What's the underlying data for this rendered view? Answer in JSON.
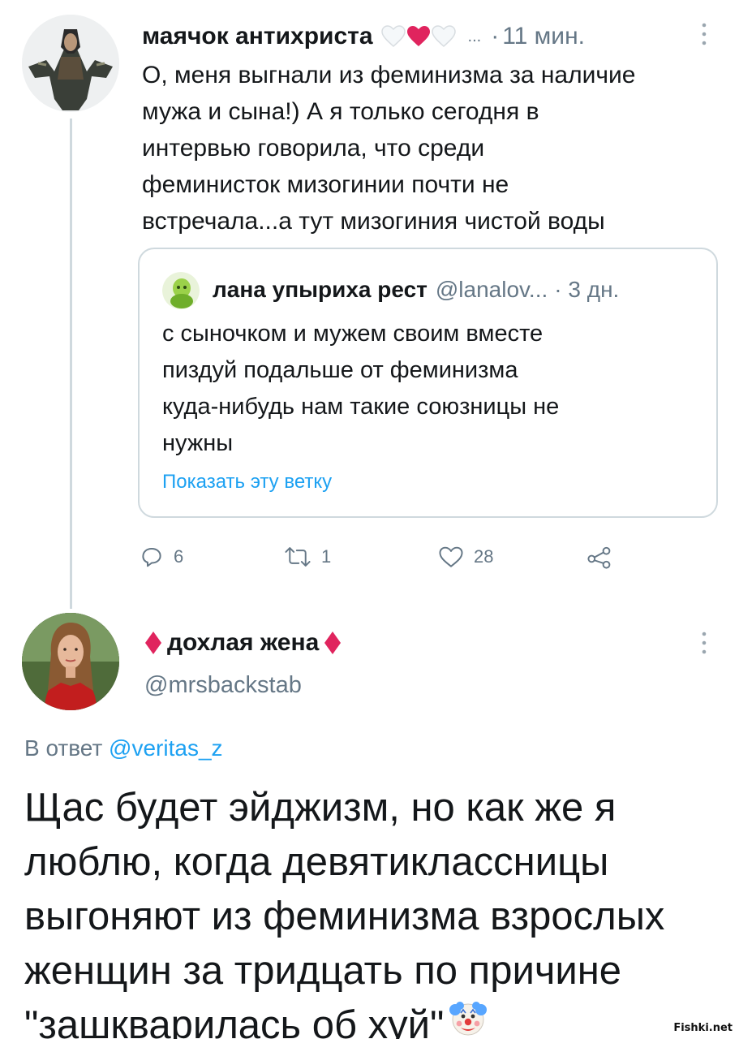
{
  "tweet1": {
    "author_name": "маячок антихриста",
    "ellipsis": "...",
    "dot": "·",
    "time": "11 мин.",
    "text": "О, меня выгнали из феминизма за наличие\nмужа и сына!) А я только сегодня в\nинтервью говорила, что среди\nфеминисток мизогинии почти не\nвстречала...а тут мизогиния чистой воды",
    "name_icons": [
      "white-heart-icon",
      "red-heart-icon",
      "white-heart-icon"
    ],
    "quote": {
      "author_name": "лана упыриха рест",
      "handle": "@lanalov...",
      "dot_time": "· 3 дн.",
      "text": "с сыночком и мужем своим вместе\nпиздуй подальше от феминизма\nкуда-нибудь нам такие союзницы не\nнужны",
      "show_thread": "Показать эту ветку"
    },
    "actions": {
      "reply_count": "6",
      "retweet_count": "1",
      "like_count": "28"
    }
  },
  "tweet2": {
    "author_name": "дохлая жена",
    "name_icons": [
      "red-diamond-icon",
      "red-diamond-icon"
    ],
    "handle": "@mrsbackstab",
    "reply_label": "В ответ ",
    "reply_to": "@veritas_z",
    "text": "Щас будет эйджизм, но как же я\nлюблю, когда девятиклассницы\nвыгоняют из феминизма взрослых\nженщин за тридцать по причине\n\"зашкварилась об хуй\"",
    "trailing_icon": "clown-face-icon"
  },
  "watermark": "Fishki.net",
  "colors": {
    "text": "#14171a",
    "secondary": "#657786",
    "link": "#1da1f2",
    "border": "#cfd9de",
    "heart": "#e0245e",
    "diamond": "#e0245e"
  }
}
